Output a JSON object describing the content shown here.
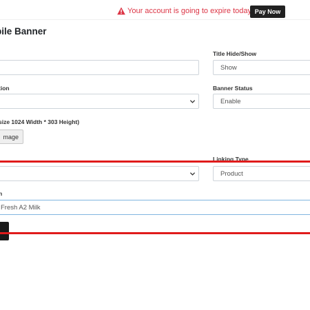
{
  "topbar": {
    "warning_text": "Your account is going to expire today.",
    "pay_now_label": "Pay Now",
    "warning_color": "#dc3545",
    "warning_icon": "warning-triangle-icon"
  },
  "page": {
    "title": "bile Banner"
  },
  "form": {
    "title_label_partial": "",
    "title_value": "",
    "title_hide_show_label": "Title Hide/Show",
    "title_hide_show_value": "Show",
    "position_label": "tion",
    "position_value": "",
    "banner_status_label": "Banner Status",
    "banner_status_value": "Enable",
    "image_label": "size 1024 Width * 303 Height)",
    "choose_image_label": "mage",
    "linking_type_label": "Linking Type",
    "linking_type_value": "Product",
    "link_select_value": "",
    "link_label": "n",
    "link_value": "Fresh A2 Milk"
  }
}
